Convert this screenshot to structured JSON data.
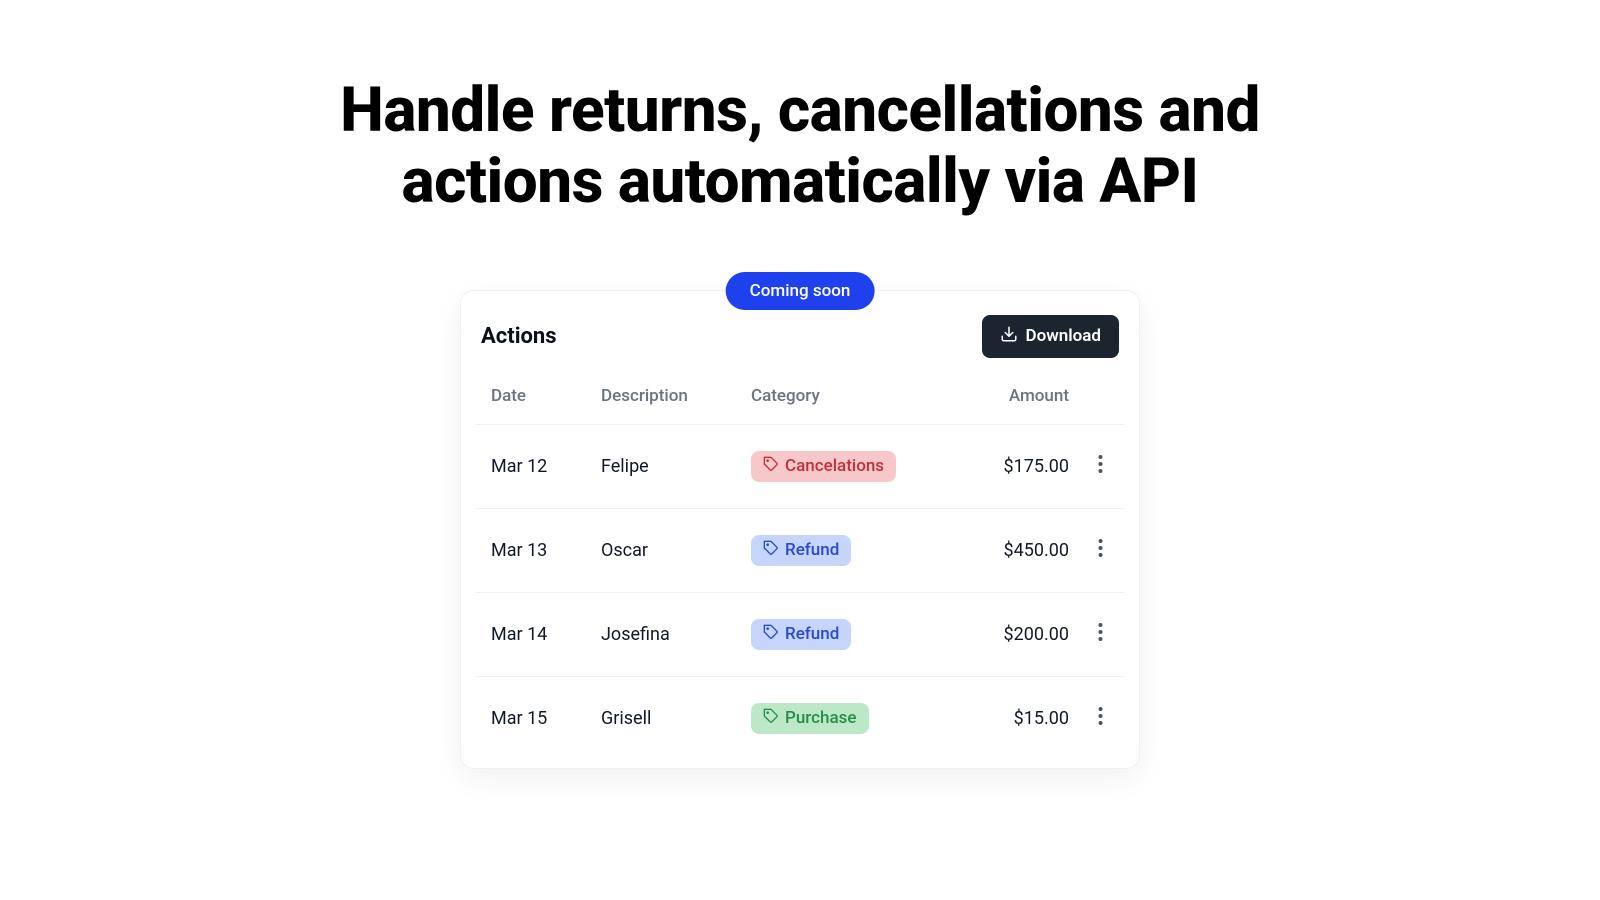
{
  "headline": "Handle returns, cancellations and actions automatically via API",
  "badge": "Coming soon",
  "card": {
    "title": "Actions",
    "download_label": "Download"
  },
  "columns": {
    "date": "Date",
    "description": "Description",
    "category": "Category",
    "amount": "Amount"
  },
  "rows": [
    {
      "date": "Mar 12",
      "description": "Felipe",
      "category": "Cancelations",
      "category_kind": "cancel",
      "amount": "$175.00"
    },
    {
      "date": "Mar 13",
      "description": "Oscar",
      "category": "Refund",
      "category_kind": "refund",
      "amount": "$450.00"
    },
    {
      "date": "Mar 14",
      "description": "Josefina",
      "category": "Refund",
      "category_kind": "refund",
      "amount": "$200.00"
    },
    {
      "date": "Mar 15",
      "description": "Grisell",
      "category": "Purchase",
      "category_kind": "purchase",
      "amount": "$15.00"
    }
  ]
}
